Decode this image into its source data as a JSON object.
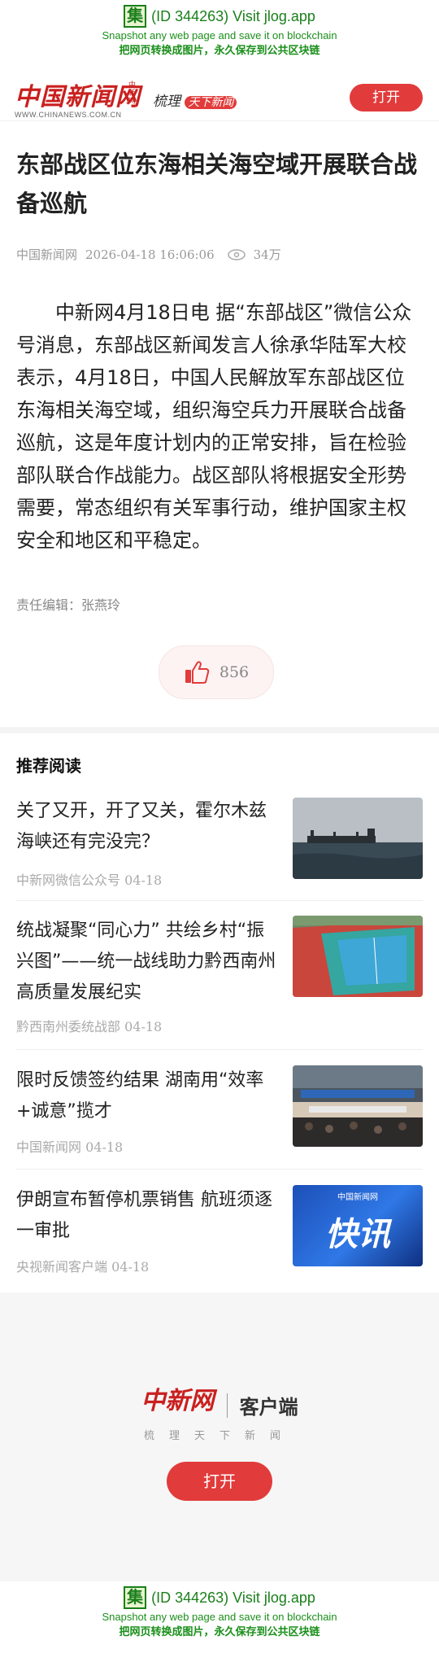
{
  "jlog": {
    "badge": "集",
    "line1": "(ID 344263) Visit jlog.app",
    "line2": "Snapshot any web page and save it on blockchain",
    "line3": "把网页转换成图片，永久保存到公共区块链"
  },
  "header": {
    "logo_text": "中国新闻网",
    "logo_sub": "中新网",
    "logo_url": "WWW.CHINANEWS.COM.CN",
    "slogan_a": "梳理",
    "slogan_b": "天下新闻",
    "open_label": "打开"
  },
  "article": {
    "title": "东部战区位东海相关海空域开展联合战备巡航",
    "source": "中国新闻网",
    "datetime": "2026-04-18 16:06:06",
    "views": "34万",
    "body": "中新网4月18日电 据“东部战区”微信公众号消息，东部战区新闻发言人徐承华陆军大校表示，4月18日，中国人民解放军东部战区位东海相关海空域，组织海空兵力开展联合战备巡航，这是年度计划内的正常安排，旨在检验部队联合作战能力。战区部队将根据安全形势需要，常态组织有关军事行动，维护国家主权安全和地区和平稳定。",
    "editor": "责任编辑：张燕玲",
    "likes": "856"
  },
  "recommend": {
    "heading": "推荐阅读",
    "items": [
      {
        "title": "关了又开，开了又关，霍尔木兹海峡还有完没完？",
        "source": "中新网微信公众号 04-18"
      },
      {
        "title": "统战凝聚“同心力” 共绘乡村“振兴图”——统一战线助力黔西南州高质量发展纪实",
        "source": "黔西南州委统战部 04-18"
      },
      {
        "title": "限时反馈签约结果 湖南用“效率+诚意”揽才",
        "source": "中国新闻网 04-18"
      },
      {
        "title": "伊朗宣布暂停机票销售 航班须逐一审批",
        "source": "央视新闻客户端 04-18"
      }
    ],
    "thumb4_text": "快讯",
    "thumb4_logo": "中国新闻网"
  },
  "footer": {
    "logo_text": "中新网",
    "client_label": "客户端",
    "slogan": "梳理天下新闻",
    "open_label": "打开"
  },
  "colors": {
    "brand_red": "#e23b3b",
    "jlog_green": "#1a7f1a"
  }
}
